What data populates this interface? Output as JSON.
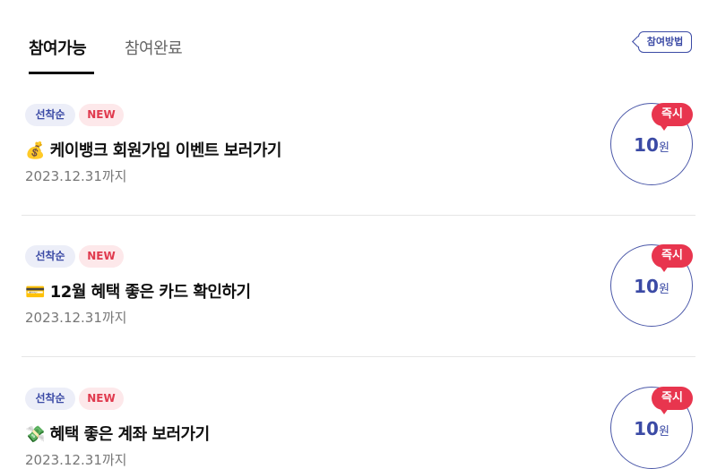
{
  "tabs": {
    "available": "참여가능",
    "completed": "참여완료"
  },
  "how_button": "참여방법",
  "items": [
    {
      "badge_first": "선착순",
      "badge_new": "NEW",
      "emoji": "💰",
      "title": "케이뱅크 회원가입 이벤트 보러가기",
      "date": "2023.12.31까지",
      "instant": "즉시",
      "amount": "10",
      "unit": "원"
    },
    {
      "badge_first": "선착순",
      "badge_new": "NEW",
      "emoji": "💳",
      "title": "12월 혜택 좋은 카드 확인하기",
      "date": "2023.12.31까지",
      "instant": "즉시",
      "amount": "10",
      "unit": "원"
    },
    {
      "badge_first": "선착순",
      "badge_new": "NEW",
      "emoji": "💸",
      "title": "혜택 좋은 계좌 보러가기",
      "date": "2023.12.31까지",
      "instant": "즉시",
      "amount": "10",
      "unit": "원"
    }
  ]
}
